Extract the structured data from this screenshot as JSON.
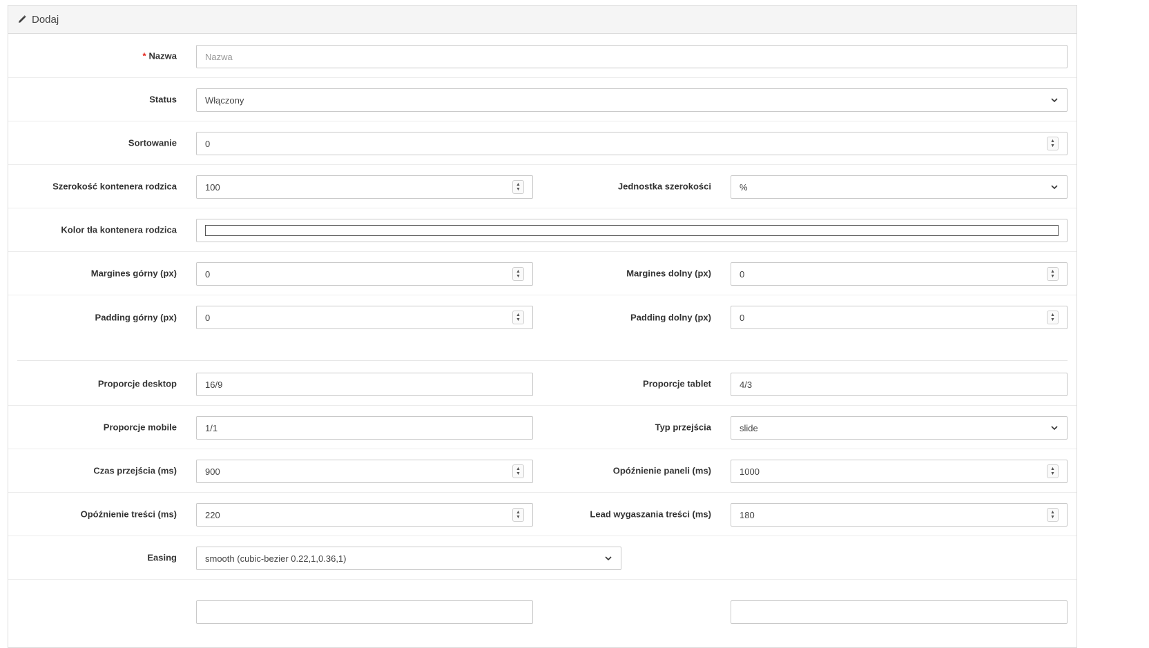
{
  "header": {
    "title": "Dodaj",
    "icon": "pencil-icon"
  },
  "fields": {
    "nazwa": {
      "label": "Nazwa",
      "required_mark": "*",
      "placeholder": "Nazwa",
      "value": ""
    },
    "status": {
      "label": "Status",
      "value": "Włączony"
    },
    "sortowanie": {
      "label": "Sortowanie",
      "value": "0"
    },
    "szerokosc": {
      "label": "Szerokość kontenera rodzica",
      "value": "100"
    },
    "jednostka": {
      "label": "Jednostka szerokości",
      "value": "%"
    },
    "kolor": {
      "label": "Kolor tła kontenera rodzica",
      "value": "#ffffff"
    },
    "margin_top": {
      "label": "Margines górny (px)",
      "value": "0"
    },
    "margin_bottom": {
      "label": "Margines dolny (px)",
      "value": "0"
    },
    "padding_top": {
      "label": "Padding górny (px)",
      "value": "0"
    },
    "padding_bottom": {
      "label": "Padding dolny (px)",
      "value": "0"
    },
    "prop_desktop": {
      "label": "Proporcje desktop",
      "value": "16/9"
    },
    "prop_tablet": {
      "label": "Proporcje tablet",
      "value": "4/3"
    },
    "prop_mobile": {
      "label": "Proporcje mobile",
      "value": "1/1"
    },
    "typ_przejscia": {
      "label": "Typ przejścia",
      "value": "slide"
    },
    "czas_przejscia": {
      "label": "Czas przejścia (ms)",
      "value": "900"
    },
    "opoznienie_paneli": {
      "label": "Opóźnienie paneli (ms)",
      "value": "1000"
    },
    "opoznienie_tresci": {
      "label": "Opóźnienie treści (ms)",
      "value": "220"
    },
    "lead_wygaszania": {
      "label": "Lead wygaszania treści (ms)",
      "value": "180"
    },
    "easing": {
      "label": "Easing",
      "value": "smooth (cubic-bezier 0.22,1,0.36,1)"
    }
  }
}
